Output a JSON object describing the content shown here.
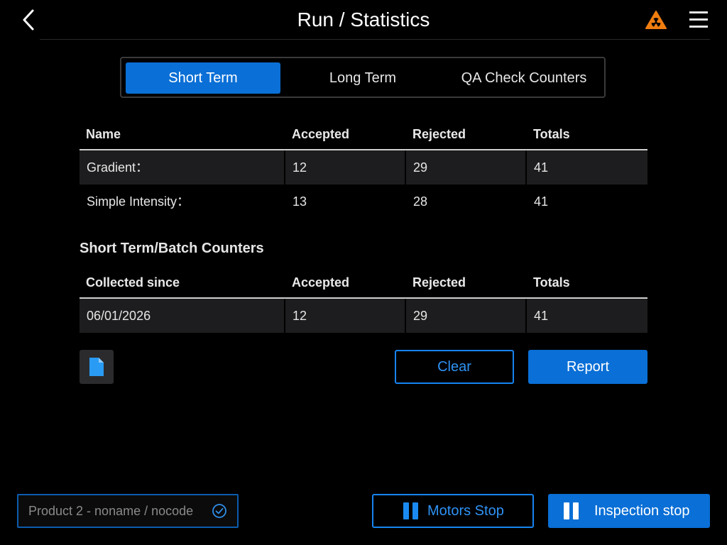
{
  "header": {
    "title": "Run / Statistics",
    "back_icon": "chevron-left-icon",
    "warning_icon": "radiation-warning-icon",
    "menu_icon": "hamburger-menu-icon"
  },
  "tabs": [
    {
      "label": "Short Term",
      "active": true
    },
    {
      "label": "Long Term",
      "active": false
    },
    {
      "label": "QA Check Counters",
      "active": false
    }
  ],
  "stats_table": {
    "columns": [
      "Name",
      "Accepted",
      "Rejected",
      "Totals"
    ],
    "rows": [
      {
        "name": "Gradient：",
        "accepted": "12",
        "rejected": "29",
        "totals": "41"
      },
      {
        "name": "Simple Intensity：",
        "accepted": "13",
        "rejected": "28",
        "totals": "41"
      }
    ]
  },
  "batch": {
    "title": "Short Term/Batch Counters",
    "columns": [
      "Collected since",
      "Accepted",
      "Rejected",
      "Totals"
    ],
    "rows": [
      {
        "since": "06/01/2026",
        "accepted": "12",
        "rejected": "29",
        "totals": "41"
      }
    ]
  },
  "actions": {
    "document_icon": "document-icon",
    "clear_label": "Clear",
    "report_label": "Report"
  },
  "footer": {
    "product_label": "Product 2 - noname / nocode",
    "product_icon": "check-circle-icon",
    "motors_label": "Motors Stop",
    "inspection_label": "Inspection stop",
    "pause_icon": "pause-icon"
  },
  "colors": {
    "accent": "#0a6fd6",
    "outline": "#1684f0",
    "warning": "#f07d10",
    "row_shade": "#1d1d1f",
    "background": "#000000"
  }
}
